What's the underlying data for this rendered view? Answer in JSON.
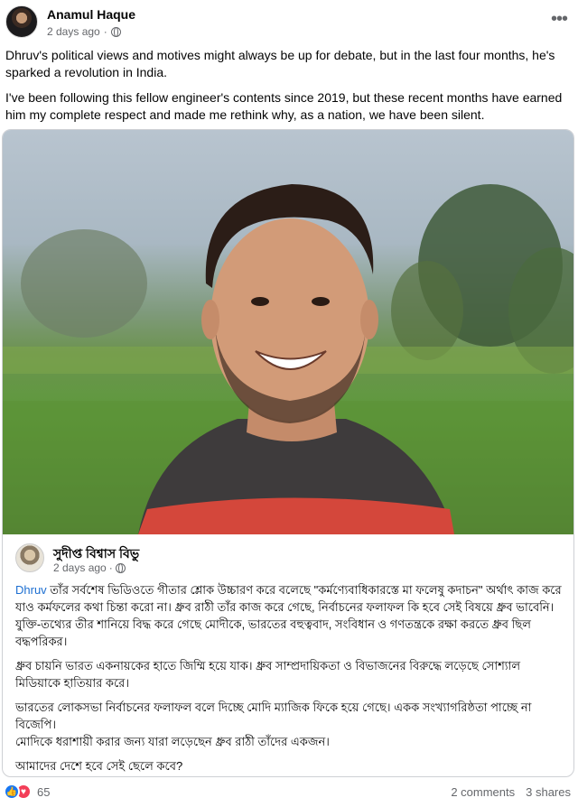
{
  "post": {
    "author": "Anamul Haque",
    "time": "2 days ago",
    "separator": "·",
    "more_label": "•••",
    "paragraphs": [
      "Dhruv's political views and motives might always be up for debate, but in the last four months, he's sparked a revolution in India.",
      "I've been following this fellow engineer's contents since 2019, but these recent months have earned him my complete respect and made me rethink why, as a nation, we have been silent."
    ]
  },
  "shared": {
    "author": "সুদীপ্ত বিশ্বাস বিভু",
    "time": "2 days ago",
    "separator": "·",
    "mention": "Dhruv",
    "para1_rest": " তাঁর সর্বশেষ ভিডিওতে গীতার শ্লোক উচ্চারণ করে বলেছে \"কর্মণ্যেবাধিকারস্তে মা ফলেষু কদাচন\" অর্থাৎ কাজ করে যাও কর্মফলের কথা চিন্তা করো না। ধ্রুব রাঠী তাঁর কাজ করে গেছে, নির্বাচনের ফলাফল কি হবে সেই বিষয়ে ধ্রুব ভাবেনি। যুক্তি-তথ্যের তীর শানিয়ে বিদ্ধ করে গেছে মোদীকে, ভারতের বহুত্ববাদ, সংবিধান ও গণতন্ত্রকে রক্ষা করতে ধ্রুব ছিল বদ্ধপরিকর।",
    "para2": "ধ্রুব চায়নি ভারত একনায়কের হাতে জিম্মি হয়ে যাক। ধ্রুব সাম্প্রদায়িকতা ও বিভাজনের বিরুদ্ধে লড়েছে সোশ্যাল মিডিয়াকে হাতিয়ার করে।",
    "para3_line1": "ভারতের লোকসভা নির্বাচনের ফলাফল বলে দিচ্ছে মোদি ম্যাজিক ফিকে হয়ে গেছে। একক সংখ্যাগরিষ্ঠতা পাচ্ছে না বিজেপি।",
    "para3_line2": "মোদিকে ধরাশায়ী করার জন্য যারা লড়েছেন ধ্রুব রাঠী তাঁদের একজন।",
    "para4": "আমাদের দেশে হবে সেই ছেলে কবে?"
  },
  "footer": {
    "reaction_count": "65",
    "comments": "2 comments",
    "shares": "3 shares"
  },
  "icons": {
    "like": "like-icon",
    "love": "love-icon",
    "globe": "globe-icon",
    "more": "more-icon"
  },
  "colors": {
    "link": "#1d6fd1",
    "meta": "#65676b",
    "like": "#1877f2",
    "love": "#f33e58"
  }
}
